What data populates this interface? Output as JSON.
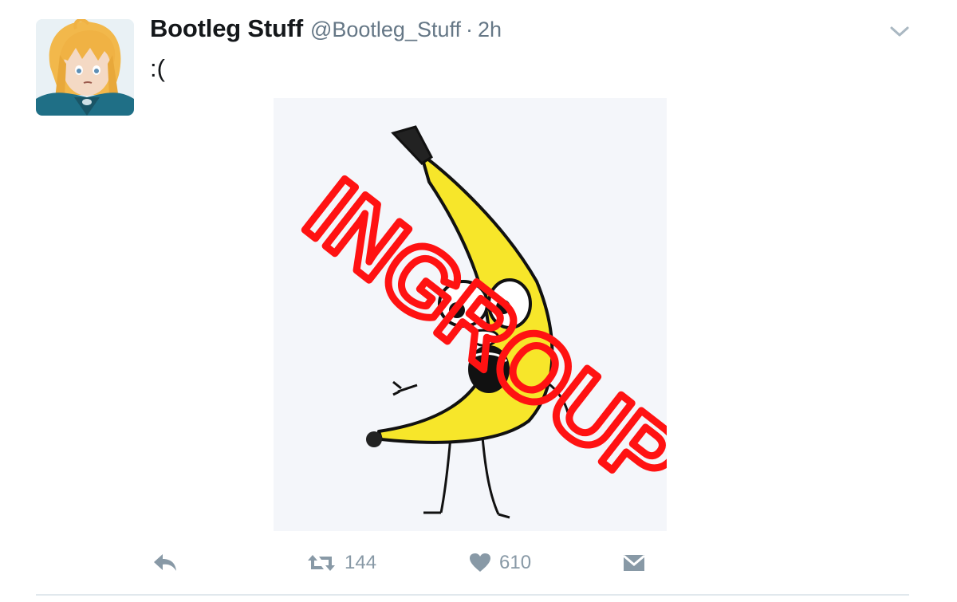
{
  "tweet": {
    "author_name": "Bootleg Stuff",
    "author_handle": "@Bootleg_Stuff",
    "separator": "·",
    "time": "2h",
    "text": ":(",
    "media": {
      "overlay_text": "INGROUP",
      "overlay_color": "#ff1212",
      "banana_color": "#f7e62a"
    }
  },
  "actions": {
    "reply": {
      "icon": "reply-icon"
    },
    "retweet": {
      "icon": "retweet-icon",
      "count": "144"
    },
    "like": {
      "icon": "heart-icon",
      "count": "610"
    },
    "message": {
      "icon": "envelope-icon"
    }
  },
  "colors": {
    "text": "#14171a",
    "muted": "#657786",
    "action_gray": "#8899a6",
    "divider": "#e1e8ed"
  }
}
